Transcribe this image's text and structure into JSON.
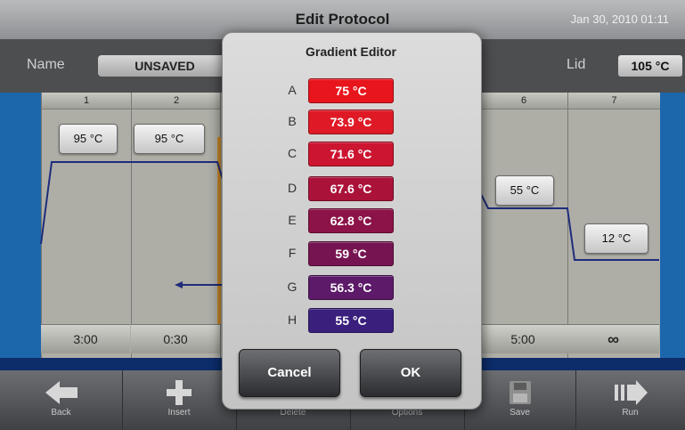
{
  "header": {
    "title": "Edit Protocol",
    "datetime": "Jan 30, 2010 01:11"
  },
  "protocol": {
    "name_label": "Name",
    "name_value": "UNSAVED",
    "lid_label": "Lid",
    "lid_value": "105 °C",
    "steps": [
      {
        "number": "1",
        "temp": "95 °C",
        "time": "3:00"
      },
      {
        "number": "2",
        "temp": "95 °C",
        "time": "0:30"
      },
      {
        "number": "6",
        "temp": "55 °C",
        "time": "5:00"
      },
      {
        "number": "7",
        "temp": "12 °C",
        "time": "∞"
      }
    ]
  },
  "dialog": {
    "title": "Gradient Editor",
    "rows": [
      {
        "letter": "A",
        "value": "75 °C",
        "color": "#e8151c"
      },
      {
        "letter": "B",
        "value": "73.9 °C",
        "color": "#df1a26"
      },
      {
        "letter": "C",
        "value": "71.6 °C",
        "color": "#cc1530"
      },
      {
        "letter": "D",
        "value": "67.6 °C",
        "color": "#ab123a"
      },
      {
        "letter": "E",
        "value": "62.8 °C",
        "color": "#8c1347"
      },
      {
        "letter": "F",
        "value": "59 °C",
        "color": "#761451"
      },
      {
        "letter": "G",
        "value": "56.3 °C",
        "color": "#5c1a68"
      },
      {
        "letter": "H",
        "value": "55 °C",
        "color": "#3a1f7d"
      }
    ],
    "cancel_label": "Cancel",
    "ok_label": "OK"
  },
  "toolbar": {
    "items": [
      {
        "label": "Back",
        "icon": "arrow-left-icon"
      },
      {
        "label": "Insert",
        "icon": "plus-icon"
      },
      {
        "label": "Delete",
        "icon": "delete-icon"
      },
      {
        "label": "Options",
        "icon": "options-icon"
      },
      {
        "label": "Save",
        "icon": "floppy-disk-icon"
      },
      {
        "label": "Run",
        "icon": "play-icon"
      }
    ]
  }
}
